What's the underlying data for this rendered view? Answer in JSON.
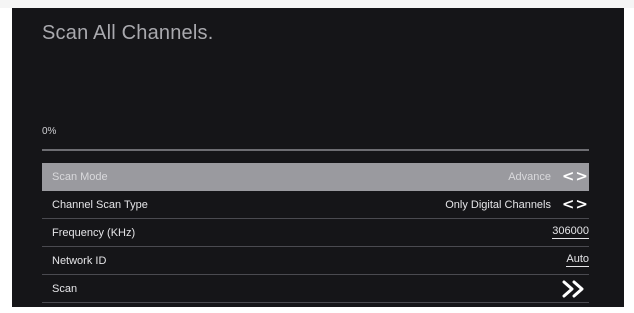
{
  "page": {
    "title": "Scan All Channels."
  },
  "progress": {
    "text": "0%",
    "fraction": 0
  },
  "menu": {
    "items": [
      {
        "label": "Scan Mode",
        "value": "Advance",
        "control": "left-right-arrows"
      },
      {
        "label": "Channel Scan Type",
        "value": "Only Digital Channels",
        "control": "left-right-arrows"
      },
      {
        "label": "Frequency (KHz)",
        "value": "306000",
        "control": "editable-field"
      },
      {
        "label": "Network ID",
        "value": "Auto",
        "control": "editable-field"
      },
      {
        "label": "Scan",
        "control": "go-arrow"
      }
    ]
  },
  "icons": {
    "left_right_arrows": "<>",
    "go_arrow": "»"
  },
  "colors": {
    "background": "#151518",
    "selected_row": "#9a9a9f",
    "text": "#e5e5e8",
    "divider": "#4a4a50"
  }
}
